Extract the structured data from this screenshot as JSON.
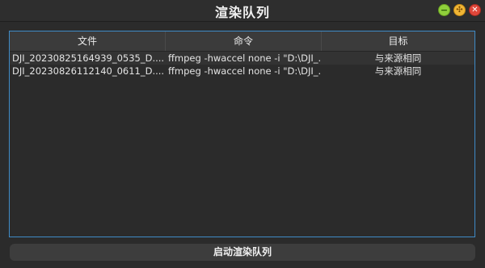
{
  "window": {
    "title": "渲染队列"
  },
  "table": {
    "headers": [
      "文件",
      "命令",
      "目标"
    ],
    "rows": [
      {
        "file": "DJI_20230825164939_0535_D....",
        "command": "ffmpeg -hwaccel none -i \"D:\\DJI_...",
        "target": "与来源相同"
      },
      {
        "file": "DJI_20230826112140_0611_D....",
        "command": "ffmpeg -hwaccel none -i \"D:\\DJI_...",
        "target": "与来源相同"
      }
    ]
  },
  "footer": {
    "start_label": "启动渲染队列"
  },
  "colors": {
    "selection_border": "#3f8bc7",
    "min_button": "#8fcf3b",
    "max_button": "#f1b636",
    "close_button": "#e0473a"
  }
}
